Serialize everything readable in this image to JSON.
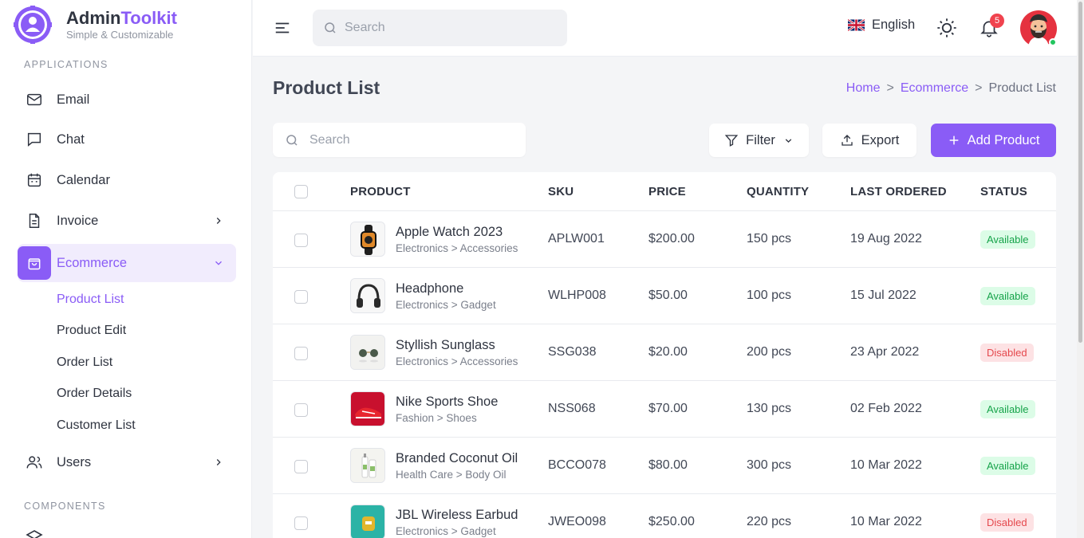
{
  "brand": {
    "name_part1": "Admin",
    "name_part2": "Toolkit",
    "tagline": "Simple & Customizable"
  },
  "sidebar": {
    "section_applications": "APPLICATIONS",
    "section_components": "COMPONENTS",
    "items": [
      {
        "label": "Email",
        "icon": "mail-icon"
      },
      {
        "label": "Chat",
        "icon": "chat-icon"
      },
      {
        "label": "Calendar",
        "icon": "calendar-icon"
      },
      {
        "label": "Invoice",
        "icon": "invoice-icon"
      },
      {
        "label": "Ecommerce",
        "icon": "shopping-bag-icon"
      },
      {
        "label": "Users",
        "icon": "users-icon"
      }
    ],
    "ecommerce_sub": [
      "Product List",
      "Product Edit",
      "Order List",
      "Order Details",
      "Customer List"
    ]
  },
  "topbar": {
    "search_placeholder": "Search",
    "language": "English",
    "notification_count": "5"
  },
  "page": {
    "title": "Product List",
    "breadcrumb": [
      "Home",
      "Ecommerce",
      "Product List"
    ]
  },
  "toolbar": {
    "search_placeholder": "Search",
    "filter_label": "Filter",
    "export_label": "Export",
    "add_label": "Add Product"
  },
  "table": {
    "columns": [
      "PRODUCT",
      "SKU",
      "PRICE",
      "QUANTITY",
      "LAST ORDERED",
      "STATUS"
    ],
    "rows": [
      {
        "name": "Apple Watch 2023",
        "category": "Electronics > Accessories",
        "sku": "APLW001",
        "price": "$200.00",
        "quantity": "150 pcs",
        "last_ordered": "19 Aug 2022",
        "status": "Available"
      },
      {
        "name": "Headphone",
        "category": "Electronics > Gadget",
        "sku": "WLHP008",
        "price": "$50.00",
        "quantity": "100 pcs",
        "last_ordered": "15 Jul 2022",
        "status": "Available"
      },
      {
        "name": "Styllish Sunglass",
        "category": "Electronics > Accessories",
        "sku": "SSG038",
        "price": "$20.00",
        "quantity": "200 pcs",
        "last_ordered": "23 Apr 2022",
        "status": "Disabled"
      },
      {
        "name": "Nike Sports Shoe",
        "category": "Fashion > Shoes",
        "sku": "NSS068",
        "price": "$70.00",
        "quantity": "130 pcs",
        "last_ordered": "02 Feb 2022",
        "status": "Available"
      },
      {
        "name": "Branded Coconut Oil",
        "category": "Health Care > Body Oil",
        "sku": "BCCO078",
        "price": "$80.00",
        "quantity": "300 pcs",
        "last_ordered": "10 Mar 2022",
        "status": "Available"
      },
      {
        "name": "JBL Wireless Earbud",
        "category": "Electronics > Gadget",
        "sku": "JWEO098",
        "price": "$250.00",
        "quantity": "220 pcs",
        "last_ordered": "10 Mar 2022",
        "status": "Disabled"
      }
    ]
  },
  "colors": {
    "accent": "#8a5cf6",
    "available_bg": "#dcfce7",
    "available_text": "#16a34a",
    "disabled_bg": "#fde2e4",
    "disabled_text": "#e5484d"
  }
}
